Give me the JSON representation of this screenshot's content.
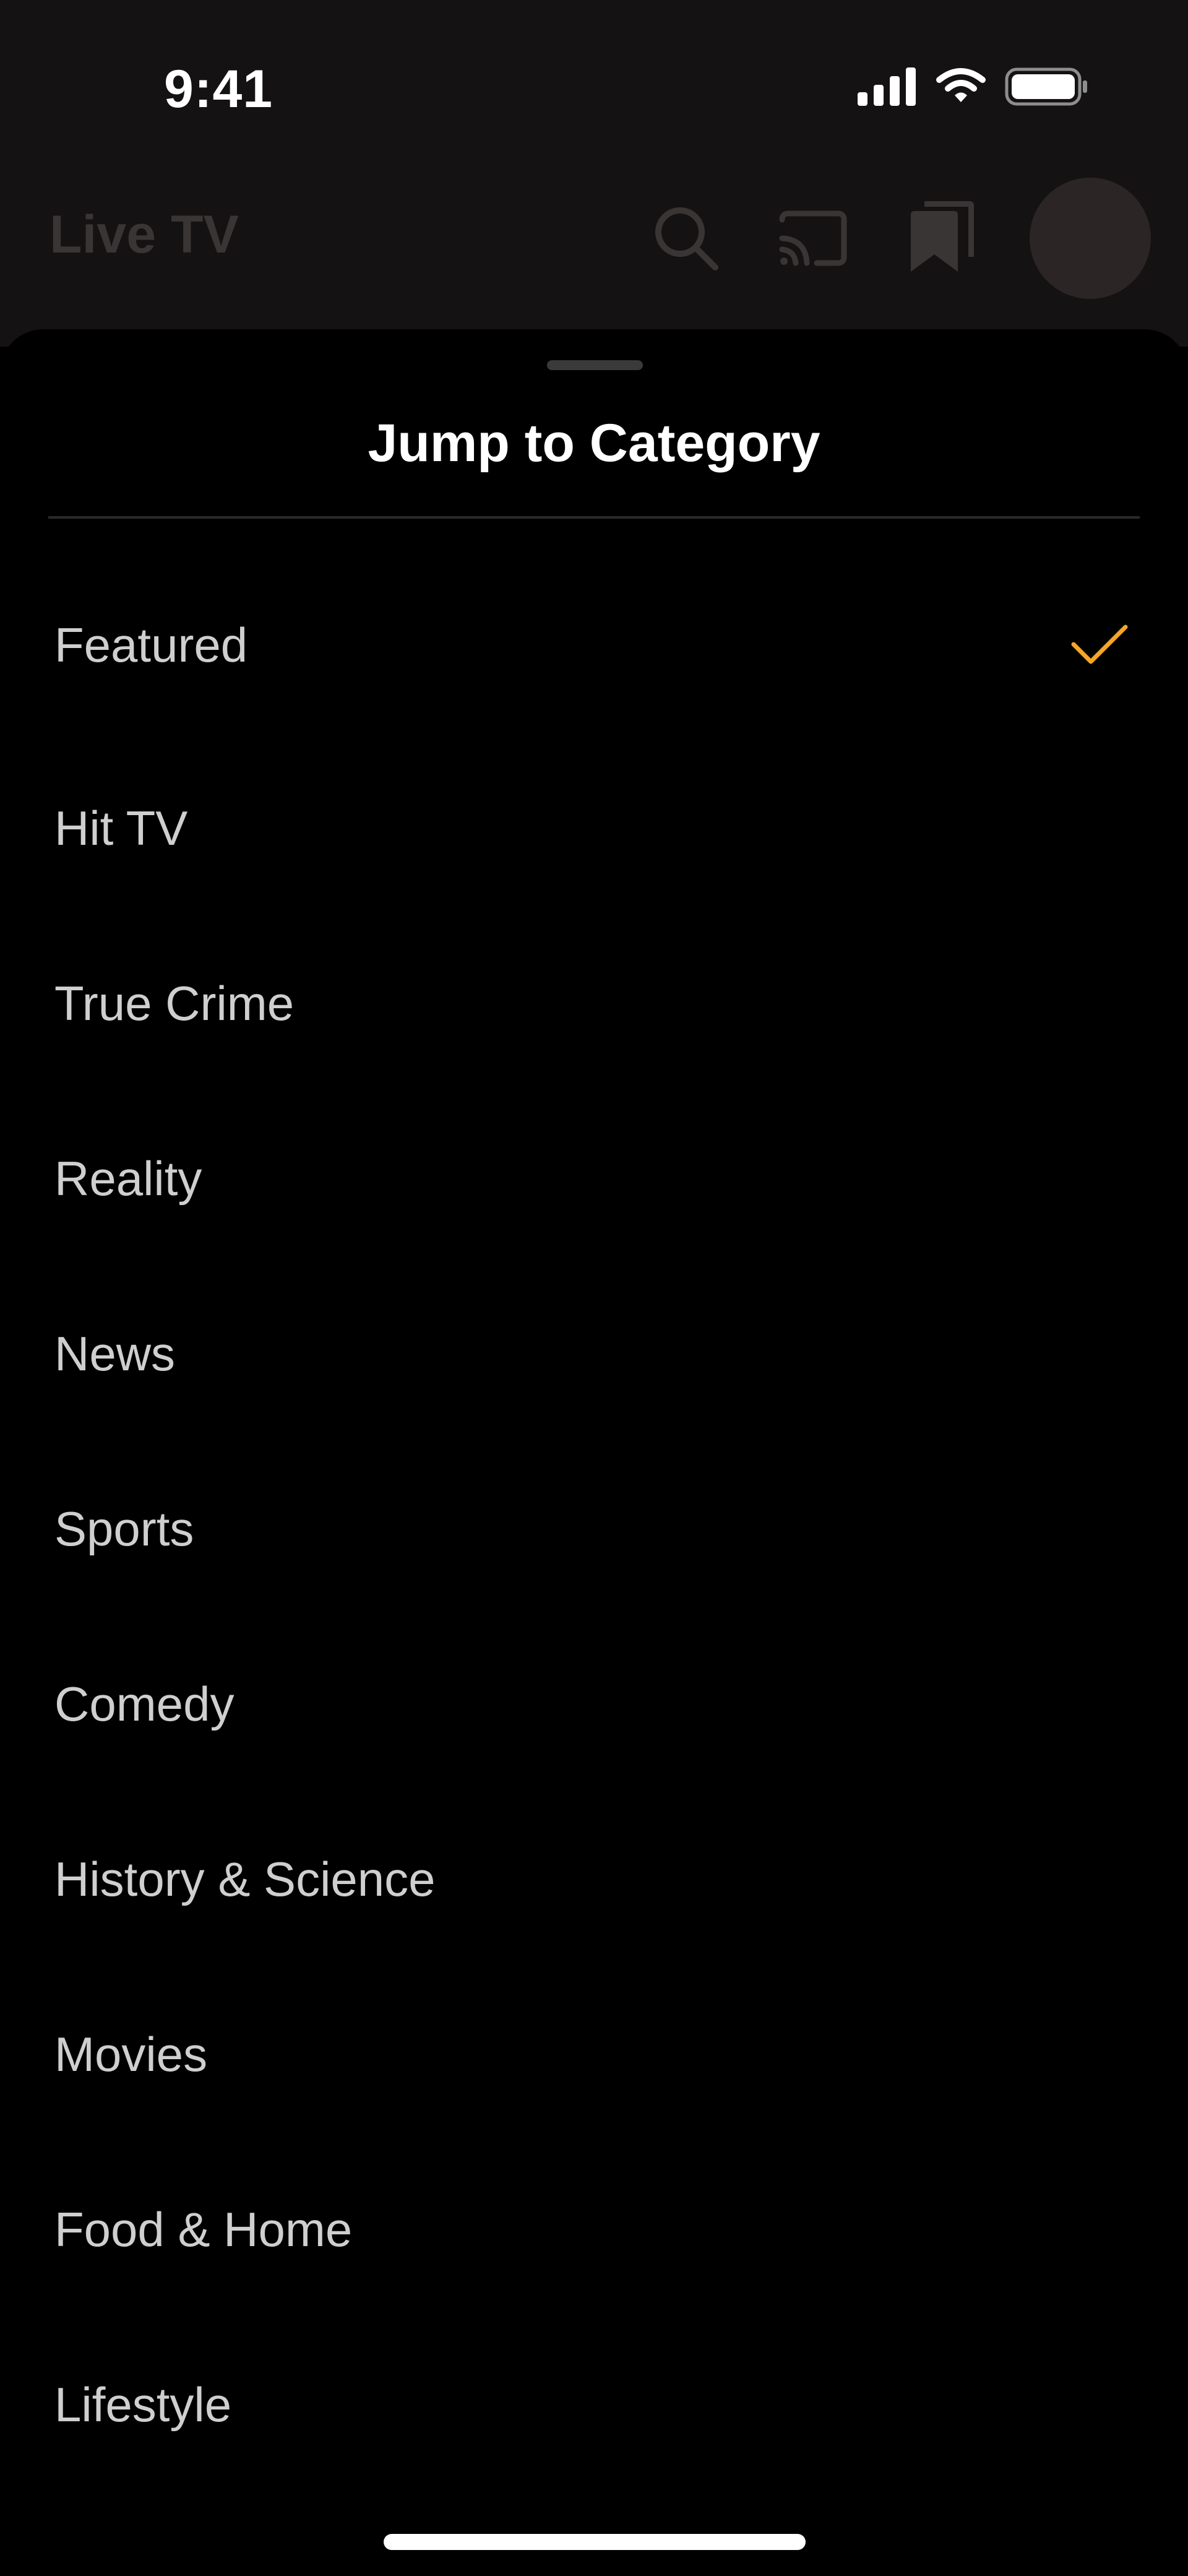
{
  "status_bar": {
    "time": "9:41"
  },
  "header": {
    "title": "Live TV",
    "icons": [
      "search-icon",
      "cast-icon",
      "bookmarks-icon"
    ]
  },
  "sheet": {
    "title": "Jump to Category",
    "selected": "Featured",
    "accent_color": "#f5a623",
    "items": [
      {
        "label": "Featured"
      },
      {
        "label": "Hit TV"
      },
      {
        "label": "True Crime"
      },
      {
        "label": "Reality"
      },
      {
        "label": "News"
      },
      {
        "label": "Sports"
      },
      {
        "label": "Comedy"
      },
      {
        "label": "History & Science"
      },
      {
        "label": "Movies"
      },
      {
        "label": "Food & Home"
      },
      {
        "label": "Lifestyle"
      }
    ]
  }
}
